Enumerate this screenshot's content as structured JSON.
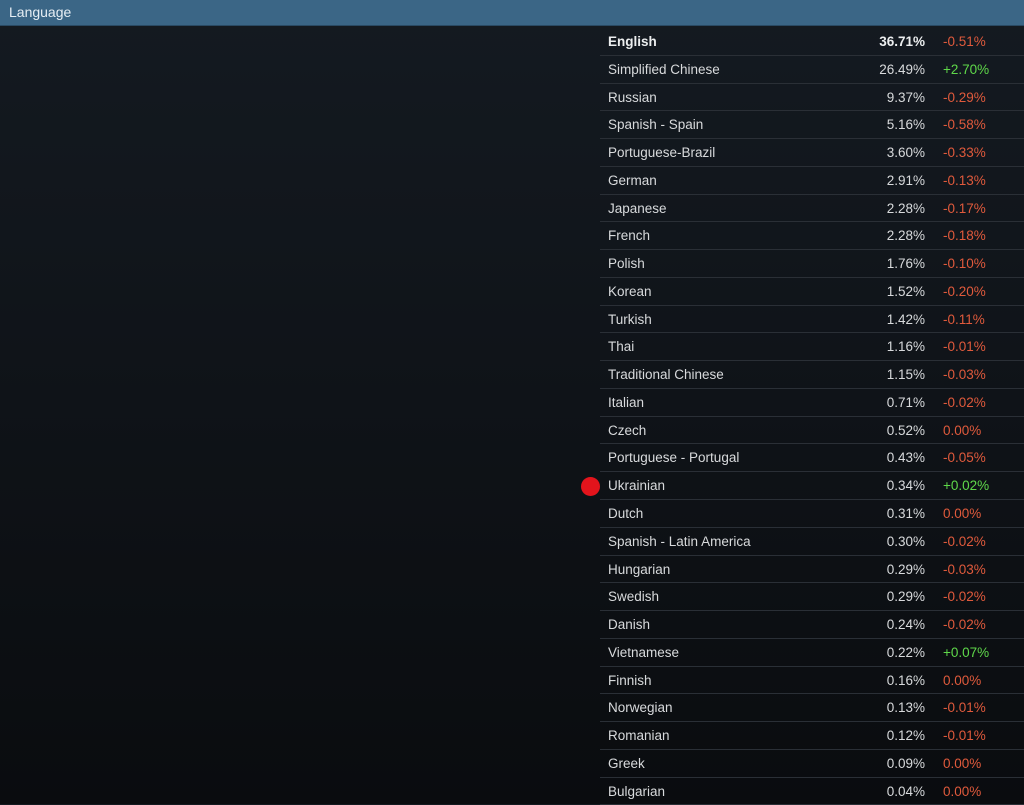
{
  "header": {
    "title": "Language"
  },
  "colors": {
    "header": "#3b6686",
    "negative": "#e05a3c",
    "positive": "#5fd84a",
    "marker": "#e3141c"
  },
  "marker": {
    "icon": "red-dot-icon",
    "row": "Ukrainian"
  },
  "rows": [
    {
      "name": "English",
      "pct": "36.71%",
      "change": "-0.51%"
    },
    {
      "name": "Simplified Chinese",
      "pct": "26.49%",
      "change": "+2.70%"
    },
    {
      "name": "Russian",
      "pct": "9.37%",
      "change": "-0.29%"
    },
    {
      "name": "Spanish - Spain",
      "pct": "5.16%",
      "change": "-0.58%"
    },
    {
      "name": "Portuguese-Brazil",
      "pct": "3.60%",
      "change": "-0.33%"
    },
    {
      "name": "German",
      "pct": "2.91%",
      "change": "-0.13%"
    },
    {
      "name": "Japanese",
      "pct": "2.28%",
      "change": "-0.17%"
    },
    {
      "name": "French",
      "pct": "2.28%",
      "change": "-0.18%"
    },
    {
      "name": "Polish",
      "pct": "1.76%",
      "change": "-0.10%"
    },
    {
      "name": "Korean",
      "pct": "1.52%",
      "change": "-0.20%"
    },
    {
      "name": "Turkish",
      "pct": "1.42%",
      "change": "-0.11%"
    },
    {
      "name": "Thai",
      "pct": "1.16%",
      "change": "-0.01%"
    },
    {
      "name": "Traditional Chinese",
      "pct": "1.15%",
      "change": "-0.03%"
    },
    {
      "name": "Italian",
      "pct": "0.71%",
      "change": "-0.02%"
    },
    {
      "name": "Czech",
      "pct": "0.52%",
      "change": "0.00%"
    },
    {
      "name": "Portuguese - Portugal",
      "pct": "0.43%",
      "change": "-0.05%"
    },
    {
      "name": "Ukrainian",
      "pct": "0.34%",
      "change": "+0.02%"
    },
    {
      "name": "Dutch",
      "pct": "0.31%",
      "change": "0.00%"
    },
    {
      "name": "Spanish - Latin America",
      "pct": "0.30%",
      "change": "-0.02%"
    },
    {
      "name": "Hungarian",
      "pct": "0.29%",
      "change": "-0.03%"
    },
    {
      "name": "Swedish",
      "pct": "0.29%",
      "change": "-0.02%"
    },
    {
      "name": "Danish",
      "pct": "0.24%",
      "change": "-0.02%"
    },
    {
      "name": "Vietnamese",
      "pct": "0.22%",
      "change": "+0.07%"
    },
    {
      "name": "Finnish",
      "pct": "0.16%",
      "change": "0.00%"
    },
    {
      "name": "Norwegian",
      "pct": "0.13%",
      "change": "-0.01%"
    },
    {
      "name": "Romanian",
      "pct": "0.12%",
      "change": "-0.01%"
    },
    {
      "name": "Greek",
      "pct": "0.09%",
      "change": "0.00%"
    },
    {
      "name": "Bulgarian",
      "pct": "0.04%",
      "change": "0.00%"
    }
  ]
}
